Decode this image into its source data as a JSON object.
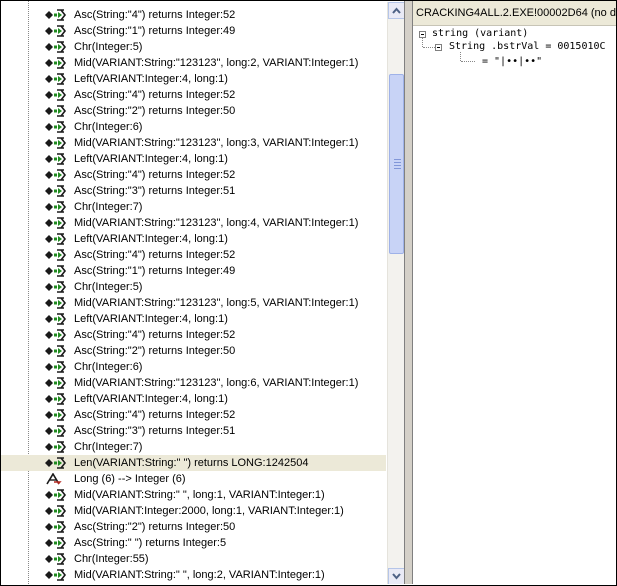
{
  "left_list": {
    "rows": [
      {
        "text": "Asc(String:\"4\") returns Integer:52",
        "icon": "call-icon"
      },
      {
        "text": "Asc(String:\"1\") returns Integer:49",
        "icon": "call-icon"
      },
      {
        "text": "Chr(Integer:5)",
        "icon": "call-icon"
      },
      {
        "text": "Mid(VARIANT:String:\"123123\", long:2, VARIANT:Integer:1)",
        "icon": "call-icon"
      },
      {
        "text": "Left(VARIANT:Integer:4, long:1)",
        "icon": "call-icon"
      },
      {
        "text": "Asc(String:\"4\") returns Integer:52",
        "icon": "call-icon"
      },
      {
        "text": "Asc(String:\"2\") returns Integer:50",
        "icon": "call-icon"
      },
      {
        "text": "Chr(Integer:6)",
        "icon": "call-icon"
      },
      {
        "text": "Mid(VARIANT:String:\"123123\", long:3, VARIANT:Integer:1)",
        "icon": "call-icon"
      },
      {
        "text": "Left(VARIANT:Integer:4, long:1)",
        "icon": "call-icon"
      },
      {
        "text": "Asc(String:\"4\") returns Integer:52",
        "icon": "call-icon"
      },
      {
        "text": "Asc(String:\"3\") returns Integer:51",
        "icon": "call-icon"
      },
      {
        "text": "Chr(Integer:7)",
        "icon": "call-icon"
      },
      {
        "text": "Mid(VARIANT:String:\"123123\", long:4, VARIANT:Integer:1)",
        "icon": "call-icon"
      },
      {
        "text": "Left(VARIANT:Integer:4, long:1)",
        "icon": "call-icon"
      },
      {
        "text": "Asc(String:\"4\") returns Integer:52",
        "icon": "call-icon"
      },
      {
        "text": "Asc(String:\"1\") returns Integer:49",
        "icon": "call-icon"
      },
      {
        "text": "Chr(Integer:5)",
        "icon": "call-icon"
      },
      {
        "text": "Mid(VARIANT:String:\"123123\", long:5, VARIANT:Integer:1)",
        "icon": "call-icon"
      },
      {
        "text": "Left(VARIANT:Integer:4, long:1)",
        "icon": "call-icon"
      },
      {
        "text": "Asc(String:\"4\") returns Integer:52",
        "icon": "call-icon"
      },
      {
        "text": "Asc(String:\"2\") returns Integer:50",
        "icon": "call-icon"
      },
      {
        "text": "Chr(Integer:6)",
        "icon": "call-icon"
      },
      {
        "text": "Mid(VARIANT:String:\"123123\", long:6, VARIANT:Integer:1)",
        "icon": "call-icon"
      },
      {
        "text": "Left(VARIANT:Integer:4, long:1)",
        "icon": "call-icon"
      },
      {
        "text": "Asc(String:\"4\") returns Integer:52",
        "icon": "call-icon"
      },
      {
        "text": "Asc(String:\"3\") returns Integer:51",
        "icon": "call-icon"
      },
      {
        "text": "Chr(Integer:7)",
        "icon": "call-icon"
      },
      {
        "text": "Len(VARIANT:String:\"      \") returns LONG:1242504",
        "icon": "call-icon",
        "selected": true
      },
      {
        "text": "Long (6) --> Integer (6)",
        "icon": "conversion-icon"
      },
      {
        "text": "Mid(VARIANT:String:\"      \", long:1, VARIANT:Integer:1)",
        "icon": "call-icon"
      },
      {
        "text": "Mid(VARIANT:Integer:2000, long:1, VARIANT:Integer:1)",
        "icon": "call-icon"
      },
      {
        "text": "Asc(String:\"2\") returns Integer:50",
        "icon": "call-icon"
      },
      {
        "text": "Asc(String:\" \") returns Integer:5",
        "icon": "call-icon"
      },
      {
        "text": "Chr(Integer:55)",
        "icon": "call-icon"
      },
      {
        "text": "Mid(VARIANT:String:\"      \", long:2, VARIANT:Integer:1)",
        "icon": "call-icon"
      }
    ]
  },
  "right_pane": {
    "title": "CRACKING4ALL.2.EXE!00002D64 (no de",
    "tree": {
      "root": "string (variant)",
      "child": "String  .bstrVal = 0015010C",
      "value": "= \"|••|••\""
    }
  },
  "colors": {
    "selected_row": "#ece9d8",
    "icon_green": "#1f8a1f",
    "icon_dark": "#1a1a1a"
  }
}
